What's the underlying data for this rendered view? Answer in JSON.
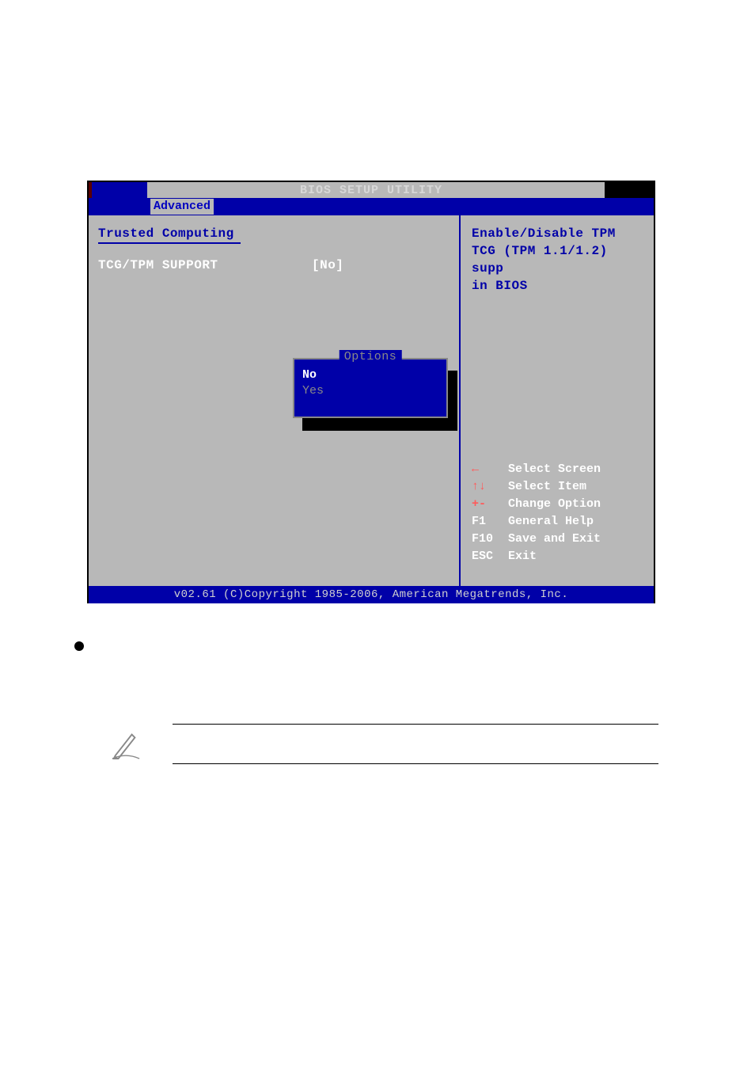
{
  "titlebar": {
    "title": "BIOS SETUP UTILITY"
  },
  "menubar": {
    "active_tab": "Advanced"
  },
  "main": {
    "section_title": "Trusted Computing",
    "setting": {
      "label": "TCG/TPM SUPPORT",
      "value": "[No]"
    }
  },
  "options_popup": {
    "title": "Options",
    "items": [
      "No",
      "Yes"
    ],
    "selected_index": 0
  },
  "help": {
    "line1": "Enable/Disable TPM",
    "line2": "TCG (TPM 1.1/1.2) supp",
    "line3": "in BIOS"
  },
  "nav": [
    {
      "key": "←",
      "desc": "Select Screen"
    },
    {
      "key": "↑↓",
      "desc": "Select Item"
    },
    {
      "key": "+-",
      "desc": "Change Option"
    },
    {
      "key": "F1",
      "desc": "General Help"
    },
    {
      "key": "F10",
      "desc": "Save and Exit"
    },
    {
      "key": "ESC",
      "desc": "Exit"
    }
  ],
  "footer": {
    "text": "v02.61 (C)Copyright 1985-2006, American Megatrends, Inc."
  }
}
